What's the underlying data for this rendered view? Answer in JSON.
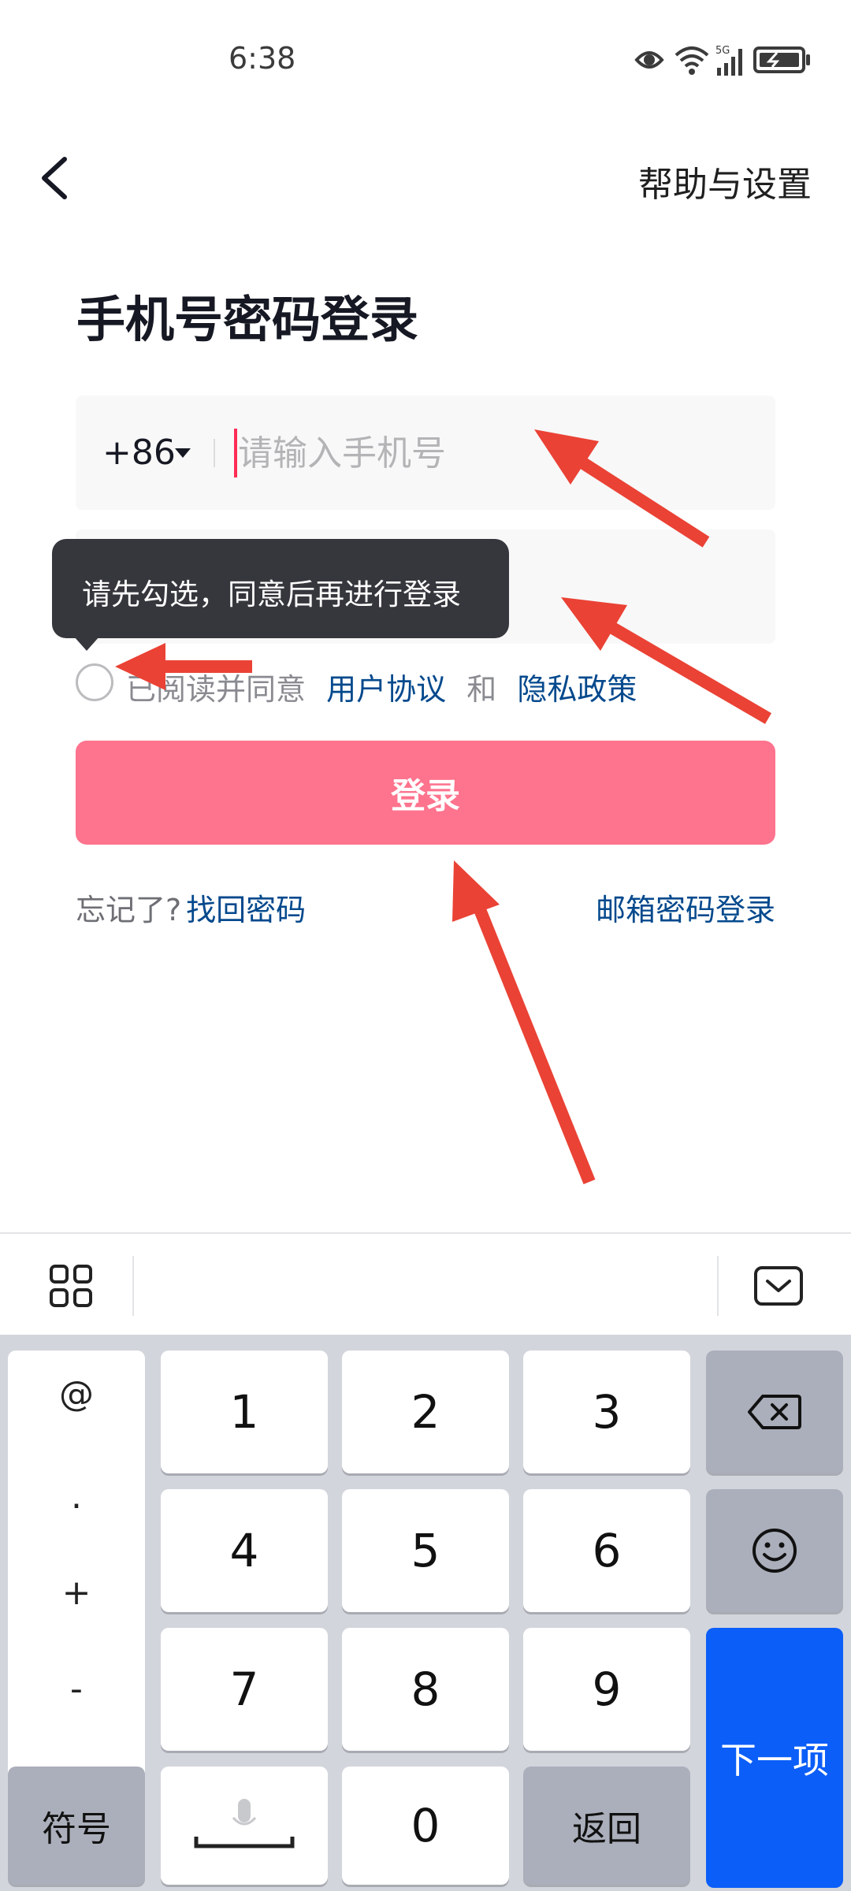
{
  "status_bar": {
    "time": "6:38",
    "signal_label": "5G",
    "icons": [
      "eye-icon",
      "wifi-icon",
      "cellular-signal-icon",
      "battery-icon"
    ]
  },
  "nav": {
    "back_icon": "chevron-left-icon",
    "help_label": "帮助与设置"
  },
  "title": "手机号密码登录",
  "phone_field": {
    "country_code": "+86",
    "placeholder": "请输入手机号",
    "value": ""
  },
  "tooltip": {
    "text": "请先勾选，同意后再进行登录"
  },
  "agreement": {
    "prefix": "已阅读并同意",
    "user_agreement": "用户协议",
    "and": "和",
    "privacy_policy": "隐私政策",
    "checked": false
  },
  "login_button": {
    "label": "登录"
  },
  "forgot": {
    "prefix": "忘记了?",
    "link": "找回密码"
  },
  "email_login": "邮箱密码登录",
  "keyboard": {
    "symbols": [
      "@",
      ".",
      "+",
      "-"
    ],
    "keys": [
      "1",
      "2",
      "3",
      "4",
      "5",
      "6",
      "7",
      "8",
      "9",
      "0"
    ],
    "symbols_key": "符号",
    "back_key": "返回",
    "next_key": "下一项",
    "icons": [
      "grid-icon",
      "keyboard-hide-icon",
      "backspace-icon",
      "emoji-icon",
      "microphone-icon"
    ]
  },
  "colors": {
    "primary_button": "#fe738d",
    "link": "#04498d",
    "cursor": "#fe2c55",
    "enter_key": "#0b5ef8",
    "annotation_arrow": "#ea4235"
  }
}
